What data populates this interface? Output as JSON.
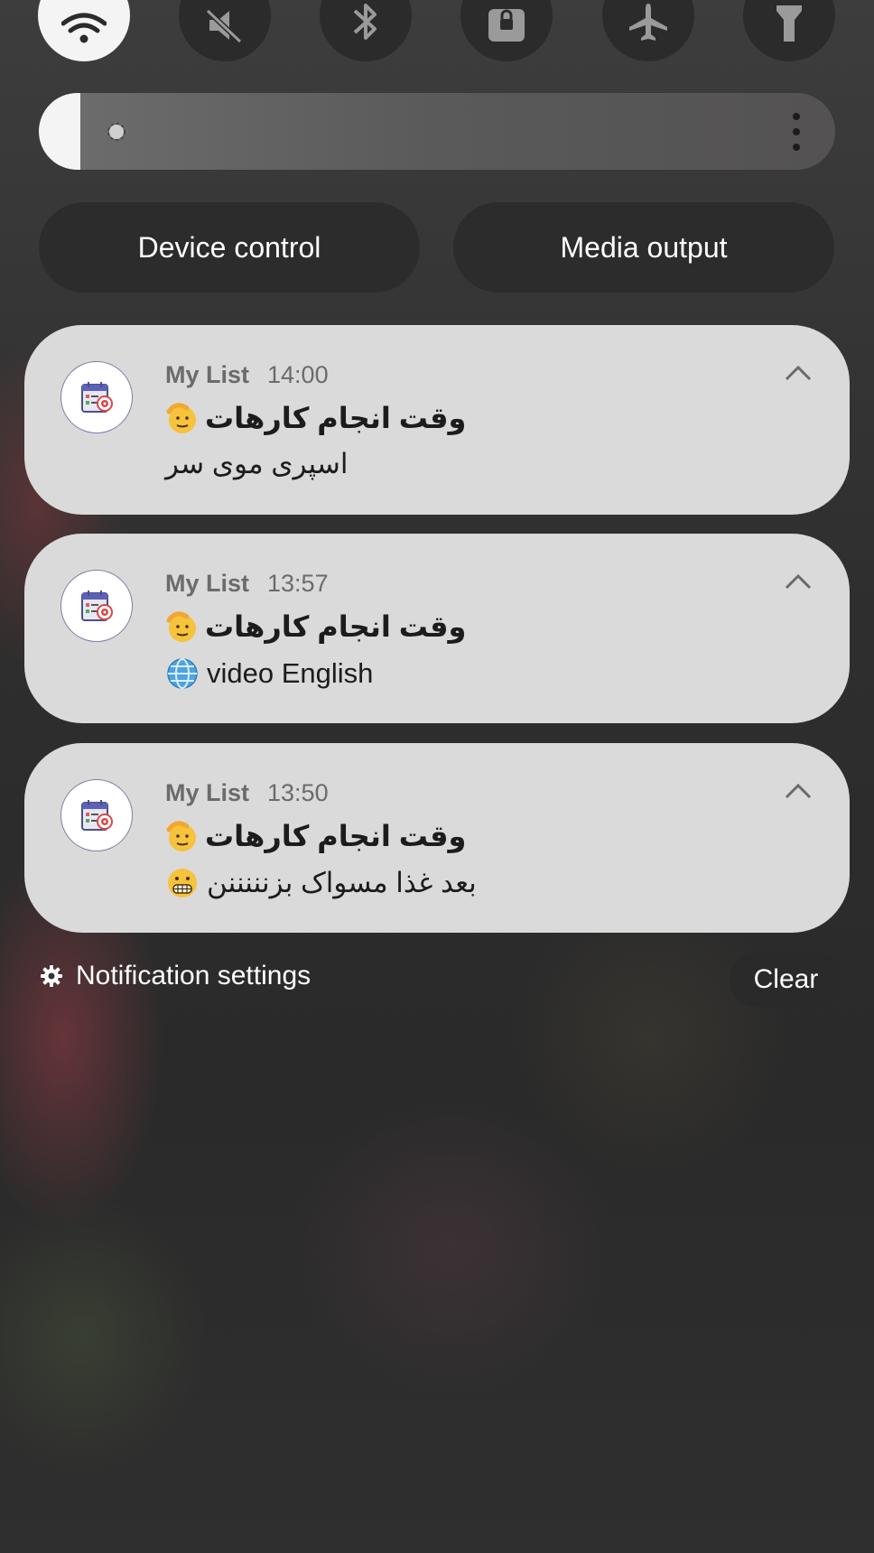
{
  "quick_toggles": [
    {
      "name": "wifi-icon",
      "active": true
    },
    {
      "name": "mute-icon",
      "active": false
    },
    {
      "name": "bluetooth-icon",
      "active": false
    },
    {
      "name": "rotation-lock-icon",
      "active": false
    },
    {
      "name": "airplane-mode-icon",
      "active": false
    },
    {
      "name": "flashlight-icon",
      "active": false
    }
  ],
  "brightness": {
    "level": 0.05
  },
  "controls": {
    "device_control": "Device control",
    "media_output": "Media output"
  },
  "notifications": [
    {
      "app": "My List",
      "time": "14:00",
      "title": "وقت انجام کارهات",
      "body": "اسپری موی سر",
      "body_emoji": ""
    },
    {
      "app": "My List",
      "time": "13:57",
      "title": "وقت انجام کارهات",
      "body": "video English",
      "body_emoji": "globe"
    },
    {
      "app": "My List",
      "time": "13:50",
      "title": "وقت انجام کارهات",
      "body": "بعد غذا مسواک بزنننننن",
      "body_emoji": "grimacing-face"
    }
  ],
  "footer": {
    "notification_settings": "Notification settings",
    "clear": "Clear"
  },
  "colors": {
    "card_bg": "#dadada",
    "toggle_active": "#f4f4f4",
    "toggle_inactive": "#2b2b2b"
  }
}
